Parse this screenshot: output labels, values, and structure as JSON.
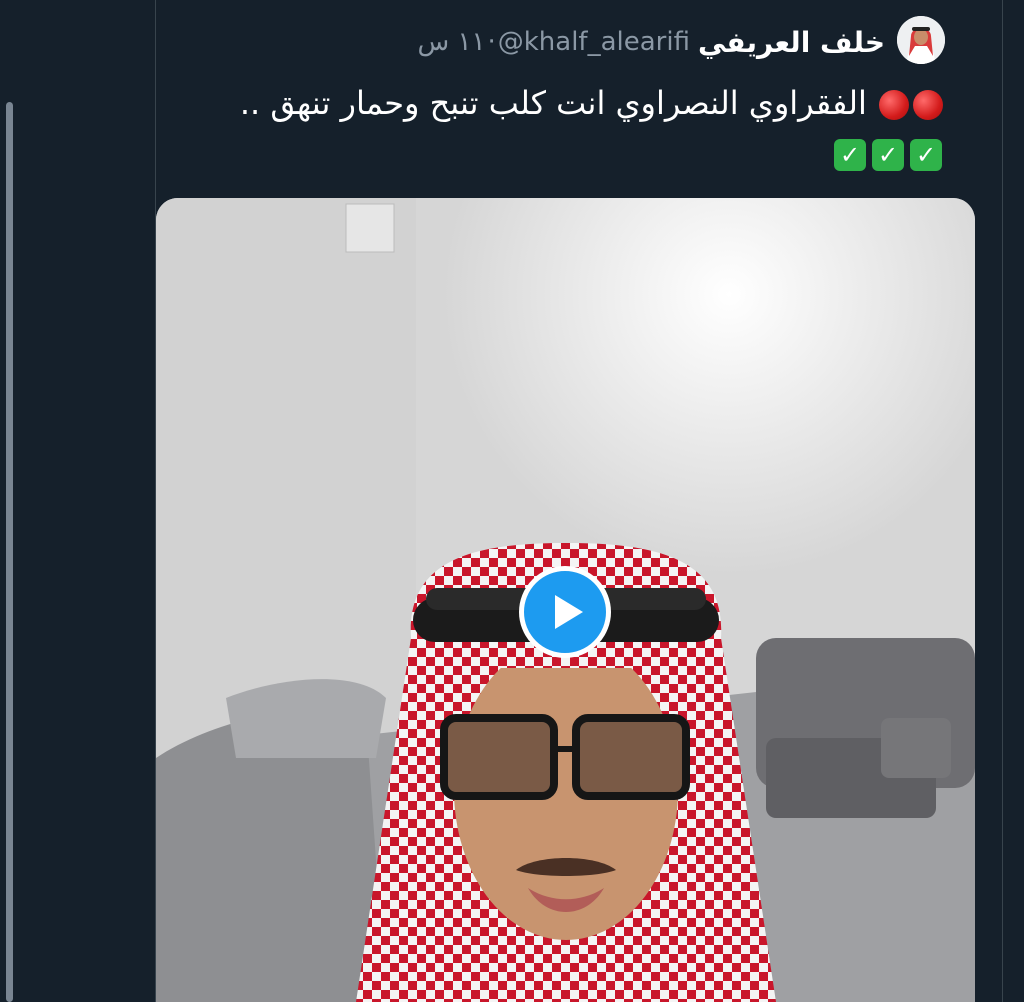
{
  "tweet": {
    "author_name": "خلف العريفي",
    "handle": "@khalf_alearifi",
    "separator": "·",
    "timestamp": "١١ س",
    "text_part1": "الفقراوي النصراوي  انت كلب تنبح وحمار تنهق ..",
    "lead_emoji": [
      "red-circle",
      "red-circle"
    ],
    "trail_emoji": [
      "green-checkmark",
      "green-checkmark",
      "green-checkmark"
    ]
  },
  "media": {
    "type": "video",
    "play_icon": "play-icon"
  },
  "colors": {
    "background": "#15202b",
    "primary_text": "#ffffff",
    "secondary_text": "#8b98a5",
    "accent": "#1d9bf0",
    "border": "#38444d"
  }
}
